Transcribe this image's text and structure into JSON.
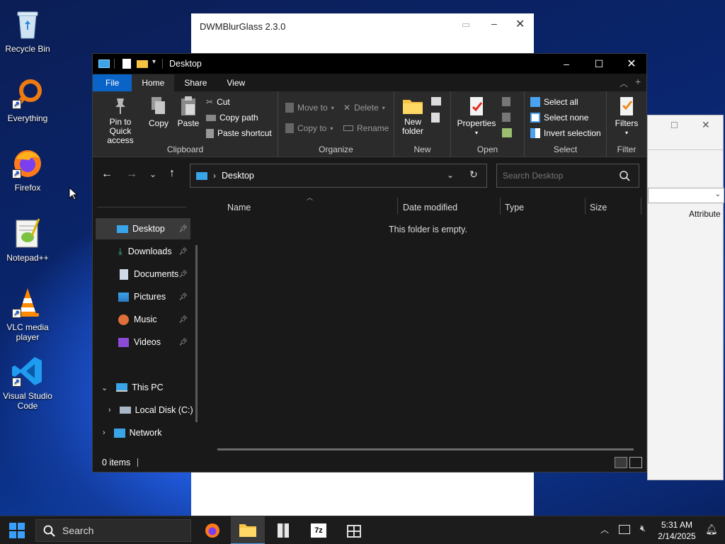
{
  "desktop": {
    "icons": [
      {
        "label": "Recycle Bin"
      },
      {
        "label": "Everything"
      },
      {
        "label": "Firefox"
      },
      {
        "label": "Notepad++"
      },
      {
        "label": "VLC media player"
      },
      {
        "label": "Visual Studio Code"
      }
    ]
  },
  "bg_window": {
    "title": "DWMBlurGlass 2.3.0"
  },
  "bg_window2": {
    "column_label": "Attribute"
  },
  "explorer": {
    "title": "Desktop",
    "tabs": {
      "file": "File",
      "home": "Home",
      "share": "Share",
      "view": "View"
    },
    "ribbon": {
      "clipboard": {
        "label": "Clipboard",
        "pin": "Pin to Quick access",
        "copy": "Copy",
        "paste": "Paste",
        "cut": "Cut",
        "copy_path": "Copy path",
        "paste_shortcut": "Paste shortcut"
      },
      "organize": {
        "label": "Organize",
        "move_to": "Move to",
        "copy_to": "Copy to",
        "delete": "Delete",
        "rename": "Rename"
      },
      "new": {
        "label": "New",
        "new_folder": "New folder"
      },
      "open": {
        "label": "Open",
        "properties": "Properties"
      },
      "select": {
        "label": "Select",
        "select_all": "Select all",
        "select_none": "Select none",
        "invert": "Invert selection"
      },
      "filter": {
        "label": "Filter",
        "filters": "Filters"
      }
    },
    "address": {
      "path": "Desktop"
    },
    "search": {
      "placeholder": "Search Desktop"
    },
    "nav": {
      "quick": [
        {
          "label": "Desktop"
        },
        {
          "label": "Downloads"
        },
        {
          "label": "Documents"
        },
        {
          "label": "Pictures"
        },
        {
          "label": "Music"
        },
        {
          "label": "Videos"
        }
      ],
      "this_pc": "This PC",
      "local_disk": "Local Disk (C:)",
      "network": "Network"
    },
    "columns": {
      "name": "Name",
      "date": "Date modified",
      "type": "Type",
      "size": "Size"
    },
    "empty_message": "This folder is empty.",
    "status": {
      "items": "0 items"
    }
  },
  "taskbar": {
    "search_label": "Search",
    "time": "5:31 AM",
    "date": "2/14/2025"
  },
  "colors": {
    "accent": "#0a64c8",
    "selected": "#3a3a3a",
    "window_bg": "#191919"
  }
}
